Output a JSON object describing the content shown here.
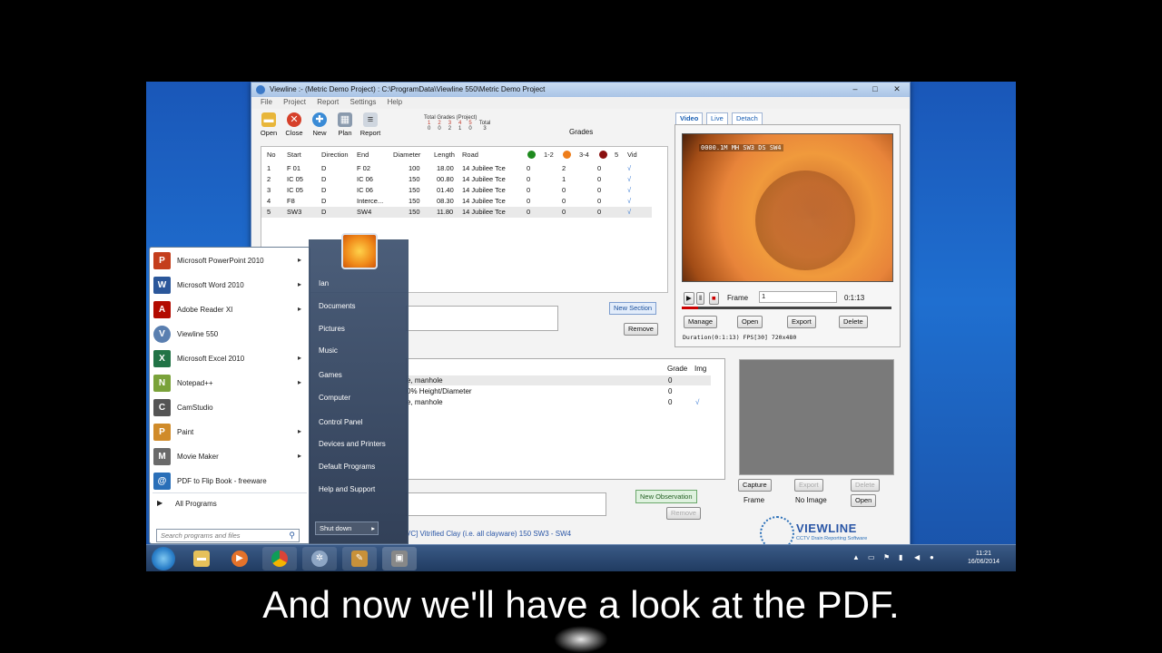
{
  "app": {
    "title": "Viewline :- (Metric Demo Project) : C:\\ProgramData\\Viewline 550\\Metric Demo Project",
    "menu": [
      "File",
      "Project",
      "Report",
      "Settings",
      "Help"
    ],
    "toolbar": [
      "Open",
      "Close",
      "New",
      "Plan",
      "Report"
    ],
    "grades_summary_title": "Total Grades (Project)",
    "grades_summary_values": [
      "1",
      "2",
      "3",
      "4",
      "5",
      "Total"
    ],
    "grades_summary_counts": [
      "0",
      "0",
      "2",
      "1",
      "0",
      "3"
    ],
    "grades_label": "Grades",
    "grid_headers": [
      "No",
      "Start",
      "Direction",
      "End",
      "Diameter",
      "Length",
      "Road",
      "1-2",
      "3-4",
      "5",
      "Vid"
    ],
    "rows": [
      {
        "no": "1",
        "start": "F 01",
        "dir": "D",
        "end": "F 02",
        "dia": "100",
        "len": "18.00",
        "road": "14 Jubilee Tce",
        "g1": "0",
        "g2": "2",
        "g3": "0",
        "vid": "√"
      },
      {
        "no": "2",
        "start": "IC 05",
        "dir": "D",
        "end": "IC 06",
        "dia": "150",
        "len": "00.80",
        "road": "14 Jubilee Tce",
        "g1": "0",
        "g2": "1",
        "g3": "0",
        "vid": "√"
      },
      {
        "no": "3",
        "start": "IC 05",
        "dir": "D",
        "end": "IC 06",
        "dia": "150",
        "len": "01.40",
        "road": "14 Jubilee Tce",
        "g1": "0",
        "g2": "0",
        "g3": "0",
        "vid": "√"
      },
      {
        "no": "4",
        "start": "F8",
        "dir": "D",
        "end": "Interce...",
        "dia": "150",
        "len": "08.30",
        "road": "14 Jubilee Tce",
        "g1": "0",
        "g2": "0",
        "g3": "0",
        "vid": "√"
      },
      {
        "no": "5",
        "start": "SW3",
        "dir": "D",
        "end": "SW4",
        "dia": "150",
        "len": "11.80",
        "road": "14 Jubilee Tce",
        "g1": "0",
        "g2": "0",
        "g3": "0",
        "vid": "√"
      }
    ],
    "video_tabs": [
      "Video",
      "Live",
      "Detach"
    ],
    "video_overlay": "0000.1M   MH SW3 DS SW4",
    "frame_label": "Frame",
    "frame_value": "1",
    "frame_time": "0:1:13",
    "video_buttons": [
      "Manage",
      "Open",
      "Export",
      "Delete"
    ],
    "video_info": "Duration(0:1:13) FPS[30] 720x480",
    "new_section": "New Section",
    "remove": "Remove",
    "obs_headers": [
      "Grade",
      "Img"
    ],
    "observations": [
      {
        "text": "e, manhole",
        "grade": "0",
        "img": ""
      },
      {
        "text": "0% Height/Diameter",
        "grade": "0",
        "img": ""
      },
      {
        "text": "e, manhole",
        "grade": "0",
        "img": "√"
      }
    ],
    "new_observation": "New Observation",
    "remove_obs": "Remove",
    "capture_buttons": [
      "Capture",
      "Export",
      "Delete"
    ],
    "frame_no_image_label": "Frame",
    "no_image": "No Image",
    "open_btn": "Open",
    "status_text": "VC] Vitrified Clay (i.e. all clayware) 150  SW3 - SW4",
    "logo_text": "VIEWLINE",
    "logo_sub": "CCTV Drain Reporting Software"
  },
  "startmenu": {
    "programs": [
      {
        "label": "Microsoft PowerPoint 2010",
        "icon": "powerpoint-icon",
        "glyph": "P",
        "color": "#c43e1c",
        "arrow": true
      },
      {
        "label": "Microsoft Word 2010",
        "icon": "word-icon",
        "glyph": "W",
        "color": "#2b579a",
        "arrow": true
      },
      {
        "label": "Adobe Reader XI",
        "icon": "adobe-reader-icon",
        "glyph": "A",
        "color": "#b30b00",
        "arrow": true
      },
      {
        "label": "Viewline 550",
        "icon": "viewline-icon",
        "glyph": "V",
        "color": "#5a7fb0",
        "arrow": false
      },
      {
        "label": "Microsoft Excel 2010",
        "icon": "excel-icon",
        "glyph": "X",
        "color": "#217346",
        "arrow": true
      },
      {
        "label": "Notepad++",
        "icon": "notepadpp-icon",
        "glyph": "N",
        "color": "#7aa23a",
        "arrow": true
      },
      {
        "label": "CamStudio",
        "icon": "camstudio-icon",
        "glyph": "C",
        "color": "#555555",
        "arrow": false
      },
      {
        "label": "Paint",
        "icon": "paint-icon",
        "glyph": "P",
        "color": "#d08b2a",
        "arrow": true
      },
      {
        "label": "Movie Maker",
        "icon": "movie-maker-icon",
        "glyph": "M",
        "color": "#6a6a6a",
        "arrow": true
      },
      {
        "label": "PDF to Flip Book - freeware",
        "icon": "pdf-flipbook-icon",
        "glyph": "@",
        "color": "#2a6fb8",
        "arrow": false
      }
    ],
    "all_programs": "All Programs",
    "search_placeholder": "Search programs and files",
    "right_links": [
      "Ian",
      "Documents",
      "Pictures",
      "Music",
      "Games",
      "Computer",
      "Control Panel",
      "Devices and Printers",
      "Default Programs",
      "Help and Support"
    ],
    "shutdown": "Shut down"
  },
  "taskbar": {
    "time": "11:21",
    "date": "16/06/2014"
  },
  "subtitle": "And now we'll have a look at the PDF."
}
